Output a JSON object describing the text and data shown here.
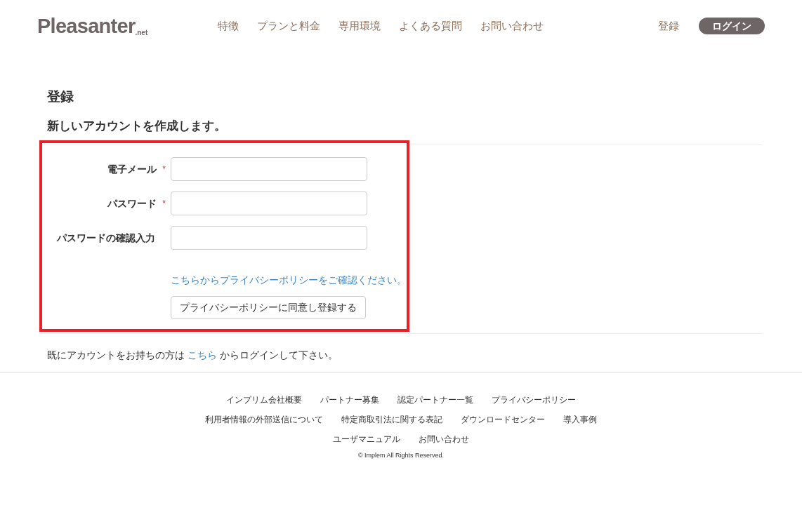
{
  "header": {
    "logo": {
      "name": "Pleasanter",
      "suffix": ".net"
    },
    "nav": [
      "特徴",
      "プランと料金",
      "専用環境",
      "よくある質問",
      "お問い合わせ"
    ],
    "register_link": "登録",
    "login_button": "ログイン"
  },
  "page": {
    "title": "登録",
    "subtitle": "新しいアカウントを作成します。",
    "form": {
      "highlighted": true,
      "fields": [
        {
          "label": "電子メール",
          "required": true
        },
        {
          "label": "パスワード",
          "required": true
        },
        {
          "label": "パスワードの確認入力",
          "required": false
        }
      ],
      "required_mark": "*",
      "privacy_link": "こちらからプライバシーポリシーをご確認ください。",
      "submit_button": "プライバシーポリシーに同意し登録する"
    },
    "login_prompt": {
      "before": "既にアカウントをお持ちの方は",
      "link": "こちら",
      "after": "からログインして下さい。"
    }
  },
  "footer": {
    "link_rows": [
      [
        "インプリム会社概要",
        "パートナー募集",
        "認定パートナー一覧",
        "プライバシーポリシー"
      ],
      [
        "利用者情報の外部送信について",
        "特定商取引法に関する表記",
        "ダウンロードセンター",
        "導入事例"
      ],
      [
        "ユーザマニュアル",
        "お問い合わせ"
      ]
    ],
    "copyright": "© Implem All Rights Reserved."
  }
}
